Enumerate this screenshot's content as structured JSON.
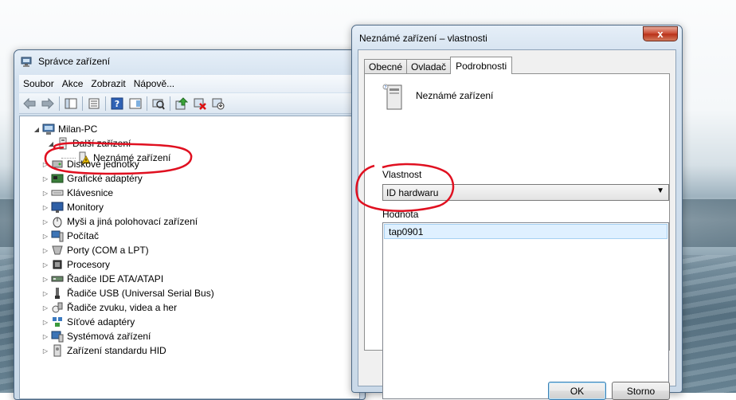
{
  "device_manager": {
    "title": "Správce zařízení",
    "menu": [
      "Soubor",
      "Akce",
      "Zobrazit",
      "Nápově..."
    ],
    "tree": {
      "root": "Milan-PC",
      "category_open": "Další zařízení",
      "unknown_device": "Neznámé zařízení",
      "items": [
        "Diskové jednotky",
        "Grafické adaptéry",
        "Klávesnice",
        "Monitory",
        "Myši a jiná polohovací zařízení",
        "Počítač",
        "Porty (COM a LPT)",
        "Procesory",
        "Řadiče IDE ATA/ATAPI",
        "Řadiče USB (Universal Serial Bus)",
        "Řadiče zvuku, videa a her",
        "Síťové adaptéry",
        "Systémová zařízení",
        "Zařízení standardu HID"
      ]
    }
  },
  "properties": {
    "title": "Neznámé zařízení – vlastnosti",
    "close": "x",
    "tabs": [
      "Obecné",
      "Ovladač",
      "Podrobnosti"
    ],
    "active_tab": "Podrobnosti",
    "device_name": "Neznámé zařízení",
    "property_label": "Vlastnost",
    "property_value": "ID hardwaru",
    "value_label": "Hodnota",
    "values": [
      "tap0901"
    ],
    "ok": "OK",
    "cancel": "Storno"
  },
  "colors": {
    "annotation": "#e01020",
    "selection": "#dff0ff"
  }
}
